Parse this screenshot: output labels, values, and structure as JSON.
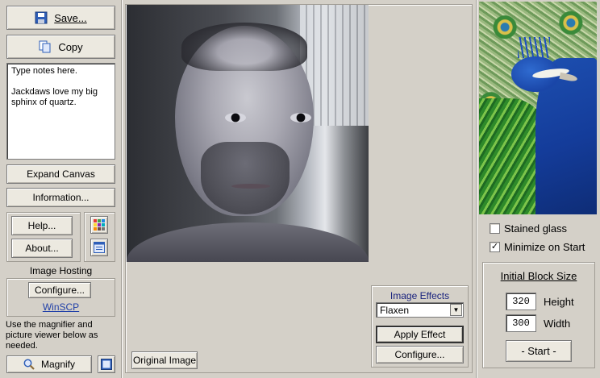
{
  "left": {
    "save_label": "Save...",
    "copy_label": "Copy",
    "notes_text": "Type notes here.\n\nJackdaws love my big sphinx of quartz.",
    "expand_canvas_label": "Expand Canvas",
    "information_label": "Information...",
    "help_label": "Help...",
    "about_label": "About...",
    "image_hosting_title": "Image Hosting",
    "configure_label": "Configure...",
    "winscp_link": "WinSCP",
    "magnifier_hint": "Use the magnifier and picture viewer below as needed.",
    "magnify_label": "Magnify"
  },
  "center": {
    "original_image_label": "Original Image",
    "effects": {
      "title": "Image Effects",
      "selected_effect": "Flaxen",
      "apply_label": "Apply Effect",
      "configure_label": "Configure..."
    }
  },
  "right": {
    "stained_glass_label": "Stained glass",
    "stained_glass_checked": false,
    "minimize_label": "Minimize on Start",
    "minimize_checked": true,
    "check_mark": "✓",
    "block_size_title": "Initial Block Size",
    "height_value": "320",
    "height_label": "Height",
    "width_value": "300",
    "width_label": "Width",
    "start_label": "- Start -"
  },
  "icons": {
    "save": "floppy-disk-icon",
    "copy": "copy-icon",
    "grid": "color-grid-icon",
    "window": "window-icon",
    "magnify": "magnifier-icon",
    "viewer": "picture-viewer-icon",
    "dropdown": "chevron-down-icon"
  },
  "colors": {
    "background": "#d4d0c8",
    "link": "#1f3fa8",
    "effects_title": "#1a237e"
  }
}
